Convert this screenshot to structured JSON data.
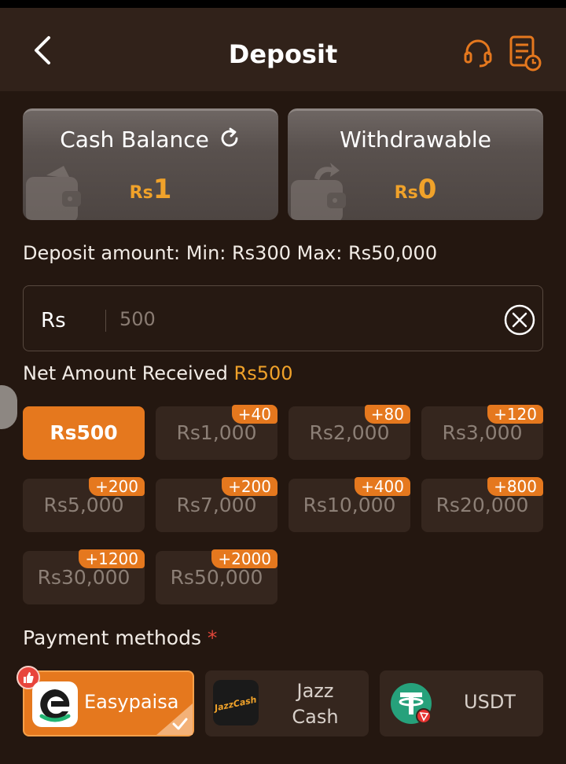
{
  "header": {
    "title": "Deposit",
    "back_icon": "chevron-left-icon",
    "support_icon": "headset-icon",
    "record_icon": "document-clock-icon"
  },
  "balances": {
    "cash": {
      "title": "Cash Balance",
      "currency": "Rs",
      "value": "1"
    },
    "withdrawable": {
      "title": "Withdrawable",
      "currency": "Rs",
      "value": "0"
    }
  },
  "deposit": {
    "range_label": "Deposit amount: Min: Rs300 Max: Rs50,000",
    "currency": "Rs",
    "placeholder": "500",
    "net_label": "Net Amount Received",
    "net_value": "Rs500"
  },
  "amounts": [
    {
      "label": "Rs500",
      "bonus": "",
      "selected": true
    },
    {
      "label": "Rs1,000",
      "bonus": "+40"
    },
    {
      "label": "Rs2,000",
      "bonus": "+80"
    },
    {
      "label": "Rs3,000",
      "bonus": "+120"
    },
    {
      "label": "Rs5,000",
      "bonus": "+200"
    },
    {
      "label": "Rs7,000",
      "bonus": "+200"
    },
    {
      "label": "Rs10,000",
      "bonus": "+400"
    },
    {
      "label": "Rs20,000",
      "bonus": "+800"
    },
    {
      "label": "Rs30,000",
      "bonus": "+1200"
    },
    {
      "label": "Rs50,000",
      "bonus": "+2000"
    }
  ],
  "payment": {
    "label": "Payment methods",
    "required_mark": "*",
    "methods": [
      {
        "name": "Easypaisa",
        "selected": true
      },
      {
        "name": "Jazz\nCash",
        "logo_text": "JazzCash"
      },
      {
        "name": "USDT"
      }
    ]
  },
  "colors": {
    "accent": "#e5781e",
    "gold": "#f0a22a",
    "background": "#241710",
    "card": "#35261e"
  }
}
